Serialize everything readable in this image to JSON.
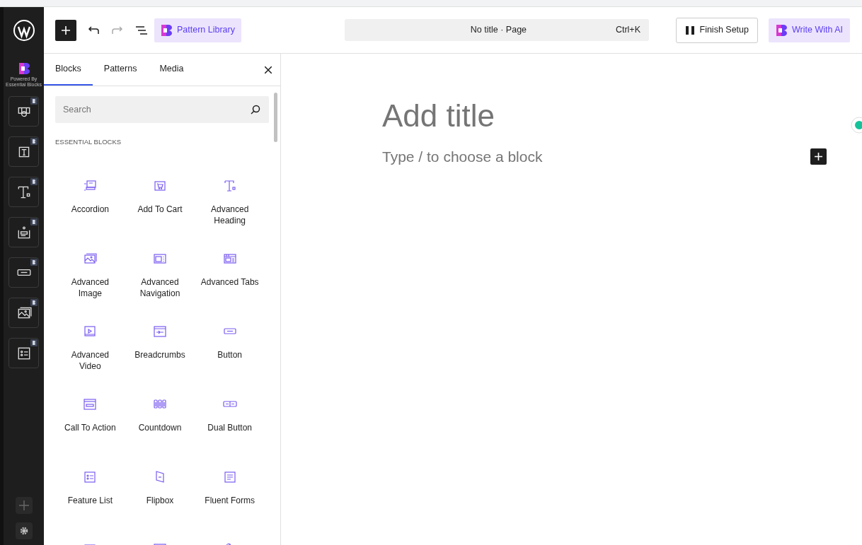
{
  "rail": {
    "powered_by": "Powered By Essential Blocks",
    "shortcuts": [
      {
        "kind": "slider"
      },
      {
        "kind": "text"
      },
      {
        "kind": "heading"
      },
      {
        "kind": "infobox"
      },
      {
        "kind": "button"
      },
      {
        "kind": "image"
      },
      {
        "kind": "list"
      }
    ]
  },
  "toolbar": {
    "pattern_library": "Pattern Library",
    "command": {
      "title": "No title · Page",
      "shortcut": "Ctrl+K"
    },
    "finish_setup": "Finish Setup",
    "write_with_ai": "Write With AI"
  },
  "inserter": {
    "tabs": [
      {
        "label": "Blocks",
        "selected": true
      },
      {
        "label": "Patterns",
        "selected": false
      },
      {
        "label": "Media",
        "selected": false
      }
    ],
    "search": {
      "placeholder": "Search"
    },
    "section_title": "ESSENTIAL BLOCKS",
    "blocks": [
      {
        "kind": "accordion",
        "label": "Accordion"
      },
      {
        "kind": "cart",
        "label": "Add To Cart"
      },
      {
        "kind": "heading",
        "label": "Advanced Heading"
      },
      {
        "kind": "image",
        "label": "Advanced Image"
      },
      {
        "kind": "navigation",
        "label": "Advanced Navigation"
      },
      {
        "kind": "tabs",
        "label": "Advanced Tabs"
      },
      {
        "kind": "video",
        "label": "Advanced Video"
      },
      {
        "kind": "breadcrumbs",
        "label": "Breadcrumbs"
      },
      {
        "kind": "button",
        "label": "Button"
      },
      {
        "kind": "cta",
        "label": "Call To Action"
      },
      {
        "kind": "countdown",
        "label": "Countdown"
      },
      {
        "kind": "dualbutton",
        "label": "Dual Button"
      },
      {
        "kind": "list",
        "label": "Feature List"
      },
      {
        "kind": "flipbox",
        "label": "Flipbox"
      },
      {
        "kind": "form",
        "label": "Fluent Forms"
      },
      {
        "kind": "rows"
      },
      {
        "kind": "map"
      },
      {
        "kind": "hand"
      }
    ]
  },
  "editor": {
    "title_placeholder": "Add title",
    "block_placeholder": "Type / to choose a block"
  }
}
